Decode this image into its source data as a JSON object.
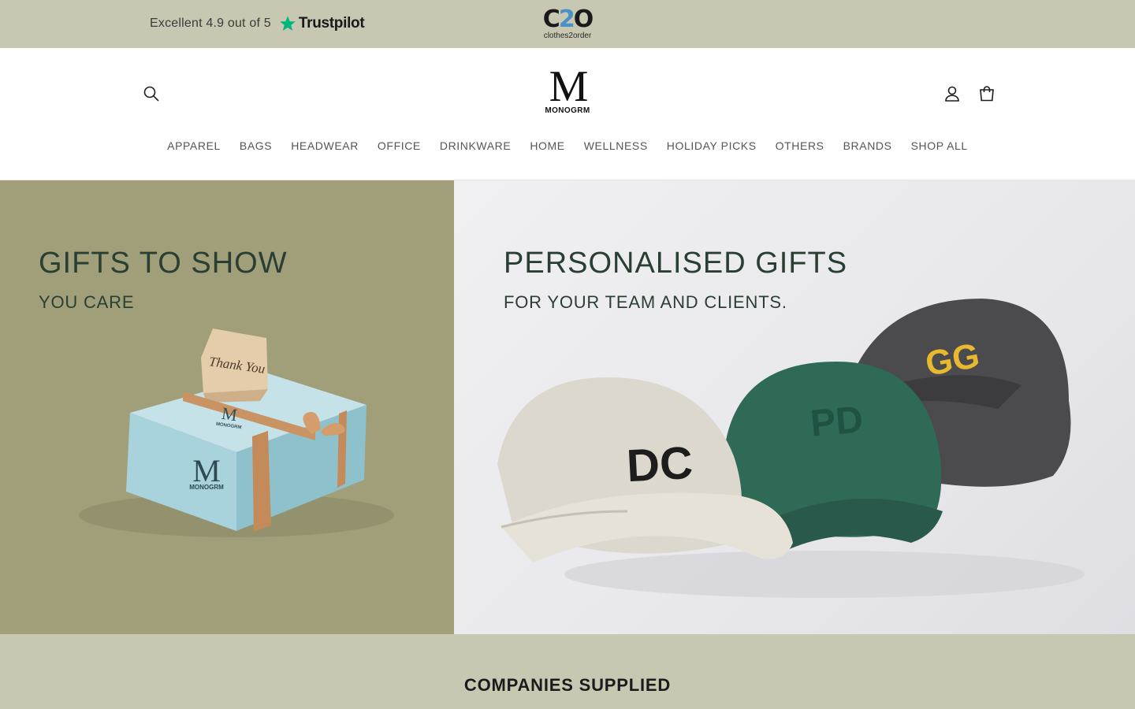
{
  "announcement": {
    "rating_text": "Excellent 4.9 out of 5",
    "review_platform": "Trustpilot",
    "partner_logo_mark_a": "C",
    "partner_logo_mark_b": "2",
    "partner_logo_mark_c": "O",
    "partner_logo_text": "clothes2order",
    "background": "#c8c7b2",
    "trustpilot_green": "#00b67a"
  },
  "header": {
    "logo_letter": "M",
    "logo_word": "MONOGRM",
    "icons": {
      "search": "search-icon",
      "account": "account-icon",
      "cart": "cart-icon"
    },
    "nav": [
      "APPAREL",
      "BAGS",
      "HEADWEAR",
      "OFFICE",
      "DRINKWARE",
      "HOME",
      "WELLNESS",
      "HOLIDAY PICKS",
      "OTHERS",
      "BRANDS",
      "SHOP ALL"
    ]
  },
  "hero": {
    "left": {
      "title": "GIFTS TO SHOW",
      "subtitle": "YOU CARE",
      "card_text": "Thank You",
      "box_brand": "MONOGRM",
      "background": "#a09f79"
    },
    "right": {
      "title": "PERSONALISED GIFTS",
      "subtitle": "FOR YOUR TEAM AND CLIENTS.",
      "caps": [
        "DC",
        "PD",
        "GG"
      ]
    },
    "text_color": "#2a3f33"
  },
  "companies": {
    "title": "COMPANIES SUPPLIED",
    "background": "#c8c7b2"
  }
}
